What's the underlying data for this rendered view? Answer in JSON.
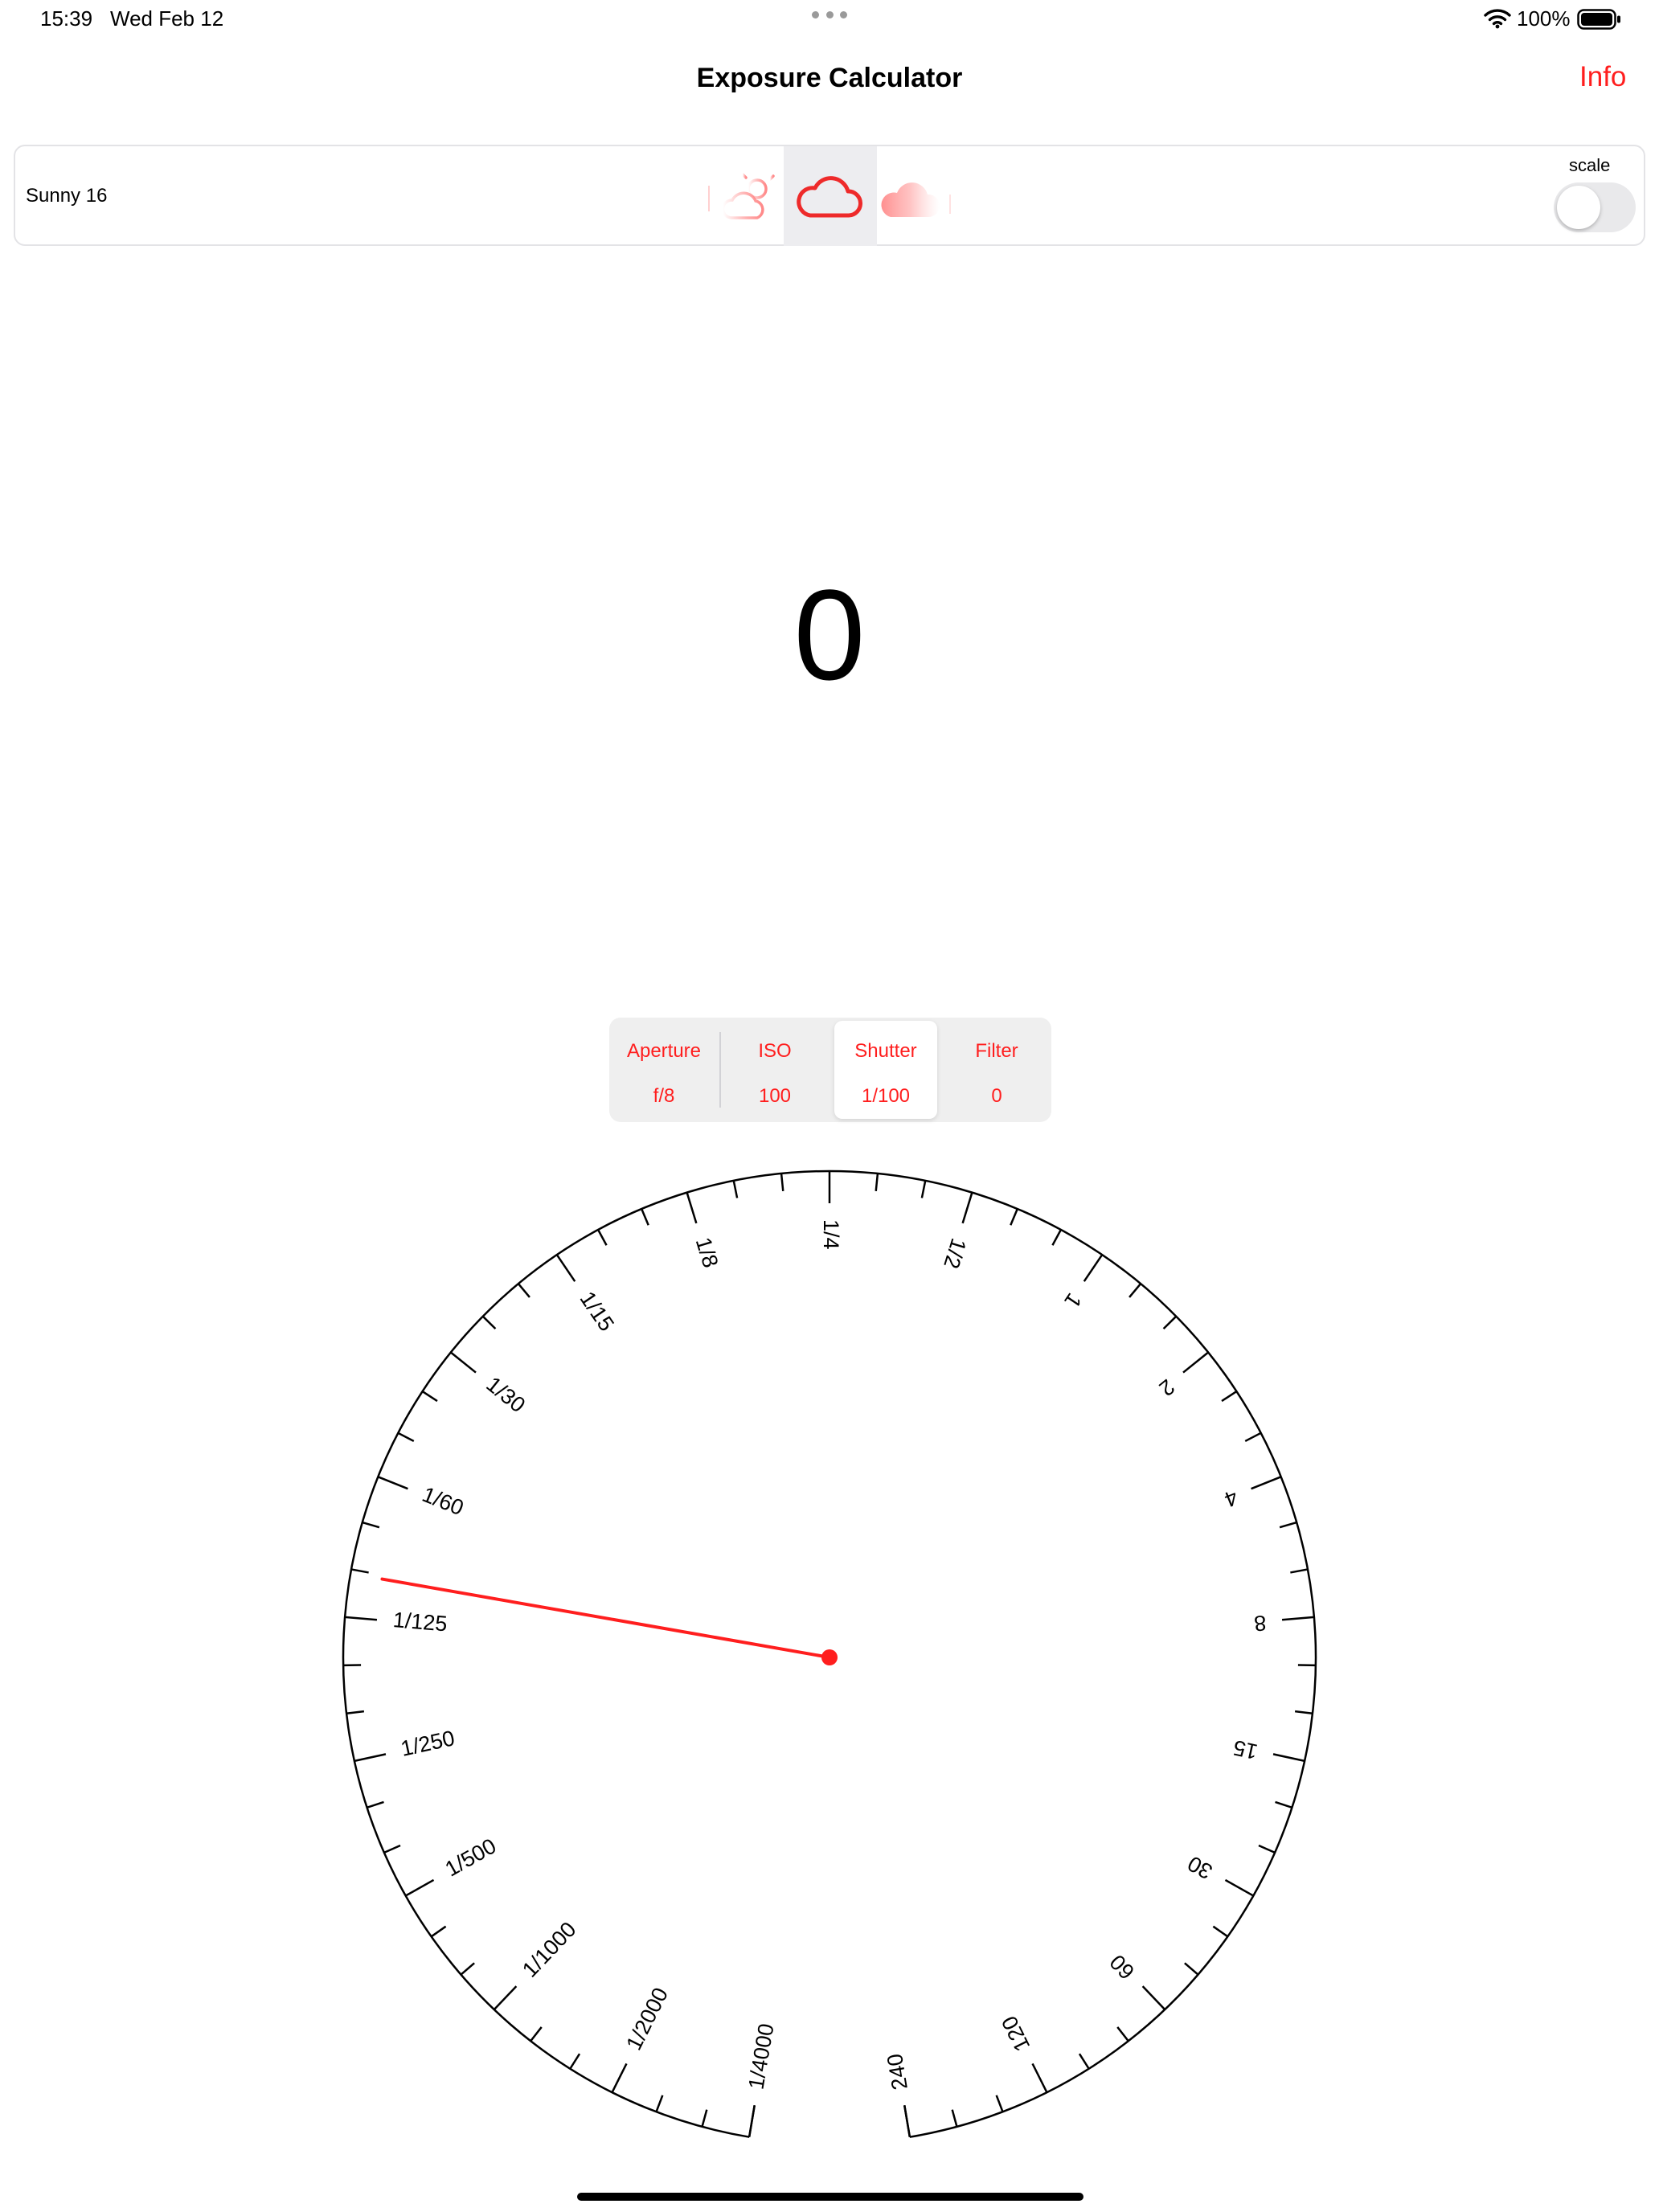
{
  "status_bar": {
    "time": "15:39",
    "date": "Wed Feb 12",
    "battery": "100%"
  },
  "nav": {
    "title": "Exposure Calculator",
    "info_label": "Info"
  },
  "weather_card": {
    "label": "Sunny 16",
    "icons": [
      "sun-behind-cloud-icon",
      "cloud-icon",
      "heavy-cloud-icon"
    ],
    "selected_icon": "cloud-icon",
    "scale_label": "scale",
    "scale_enabled": false
  },
  "exposure_value": "0",
  "segments": [
    {
      "title": "Aperture",
      "value": "f/8"
    },
    {
      "title": "ISO",
      "value": "100"
    },
    {
      "title": "Shutter",
      "value": "1/100"
    },
    {
      "title": "Filter",
      "value": "0"
    }
  ],
  "active_segment": "Shutter",
  "dial": {
    "labels": [
      "1/4000",
      "1/2000",
      "1/1000",
      "1/500",
      "1/250",
      "1/125",
      "1/60",
      "1/30",
      "1/15",
      "1/8",
      "1/4",
      "1/2",
      "1",
      "2",
      "4",
      "8",
      "15",
      "30",
      "60",
      "120",
      "240"
    ],
    "pointer_label": "1/100",
    "colors": {
      "accent": "#ff1e1e",
      "ink": "#000000"
    }
  }
}
